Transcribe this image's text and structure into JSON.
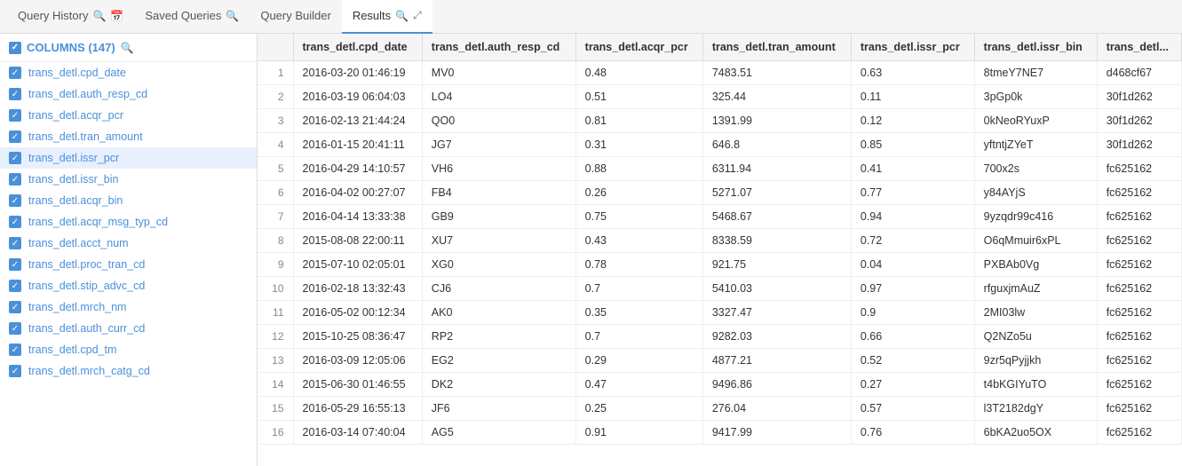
{
  "nav": {
    "items": [
      {
        "id": "query-history",
        "label": "Query History",
        "active": false,
        "icons": [
          "search",
          "calendar"
        ]
      },
      {
        "id": "saved-queries",
        "label": "Saved Queries",
        "active": false,
        "icons": [
          "search"
        ]
      },
      {
        "id": "query-builder",
        "label": "Query Builder",
        "active": false,
        "icons": []
      },
      {
        "id": "results",
        "label": "Results",
        "active": true,
        "icons": [
          "search",
          "expand"
        ]
      }
    ]
  },
  "sidebar": {
    "columns_label": "COLUMNS (147)",
    "items": [
      "trans_detl.cpd_date",
      "trans_detl.auth_resp_cd",
      "trans_detl.acqr_pcr",
      "trans_detl.tran_amount",
      "trans_detl.issr_pcr",
      "trans_detl.issr_bin",
      "trans_detl.acqr_bin",
      "trans_detl.acqr_msg_typ_cd",
      "trans_detl.acct_num",
      "trans_detl.proc_tran_cd",
      "trans_detl.stip_advc_cd",
      "trans_detl.mrch_nm",
      "trans_detl.auth_curr_cd",
      "trans_detl.cpd_tm",
      "trans_detl.mrch_catg_cd"
    ],
    "selected_index": 4
  },
  "table": {
    "columns": [
      "#",
      "trans_detl.cpd_date",
      "trans_detl.auth_resp_cd",
      "trans_detl.acqr_pcr",
      "trans_detl.tran_amount",
      "trans_detl.issr_pcr",
      "trans_detl.issr_bin",
      "trans_detl..."
    ],
    "rows": [
      [
        1,
        "2016-03-20 01:46:19",
        "MV0",
        "0.48",
        "7483.51",
        "0.63",
        "8tmeY7NE7",
        "d468cf67"
      ],
      [
        2,
        "2016-03-19 06:04:03",
        "LO4",
        "0.51",
        "325.44",
        "0.11",
        "3pGp0k",
        "30f1d262"
      ],
      [
        3,
        "2016-02-13 21:44:24",
        "QO0",
        "0.81",
        "1391.99",
        "0.12",
        "0kNeoRYuxP",
        "30f1d262"
      ],
      [
        4,
        "2016-01-15 20:41:11",
        "JG7",
        "0.31",
        "646.8",
        "0.85",
        "yftntjZYeT",
        "30f1d262"
      ],
      [
        5,
        "2016-04-29 14:10:57",
        "VH6",
        "0.88",
        "6311.94",
        "0.41",
        "700x2s",
        "fc625162"
      ],
      [
        6,
        "2016-04-02 00:27:07",
        "FB4",
        "0.26",
        "5271.07",
        "0.77",
        "y84AYjS",
        "fc625162"
      ],
      [
        7,
        "2016-04-14 13:33:38",
        "GB9",
        "0.75",
        "5468.67",
        "0.94",
        "9yzqdr99c416",
        "fc625162"
      ],
      [
        8,
        "2015-08-08 22:00:11",
        "XU7",
        "0.43",
        "8338.59",
        "0.72",
        "O6qMmuir6xPL",
        "fc625162"
      ],
      [
        9,
        "2015-07-10 02:05:01",
        "XG0",
        "0.78",
        "921.75",
        "0.04",
        "PXBAb0Vg",
        "fc625162"
      ],
      [
        10,
        "2016-02-18 13:32:43",
        "CJ6",
        "0.7",
        "5410.03",
        "0.97",
        "rfguxjmAuZ",
        "fc625162"
      ],
      [
        11,
        "2016-05-02 00:12:34",
        "AK0",
        "0.35",
        "3327.47",
        "0.9",
        "2MI03lw",
        "fc625162"
      ],
      [
        12,
        "2015-10-25 08:36:47",
        "RP2",
        "0.7",
        "9282.03",
        "0.66",
        "Q2NZo5u",
        "fc625162"
      ],
      [
        13,
        "2016-03-09 12:05:06",
        "EG2",
        "0.29",
        "4877.21",
        "0.52",
        "9zr5qPyjjkh",
        "fc625162"
      ],
      [
        14,
        "2015-06-30 01:46:55",
        "DK2",
        "0.47",
        "9496.86",
        "0.27",
        "t4bKGIYuTO",
        "fc625162"
      ],
      [
        15,
        "2016-05-29 16:55:13",
        "JF6",
        "0.25",
        "276.04",
        "0.57",
        "l3T2182dgY",
        "fc625162"
      ],
      [
        16,
        "2016-03-14 07:40:04",
        "AG5",
        "0.91",
        "9417.99",
        "0.76",
        "6bKA2uo5OX",
        "fc625162"
      ]
    ]
  }
}
